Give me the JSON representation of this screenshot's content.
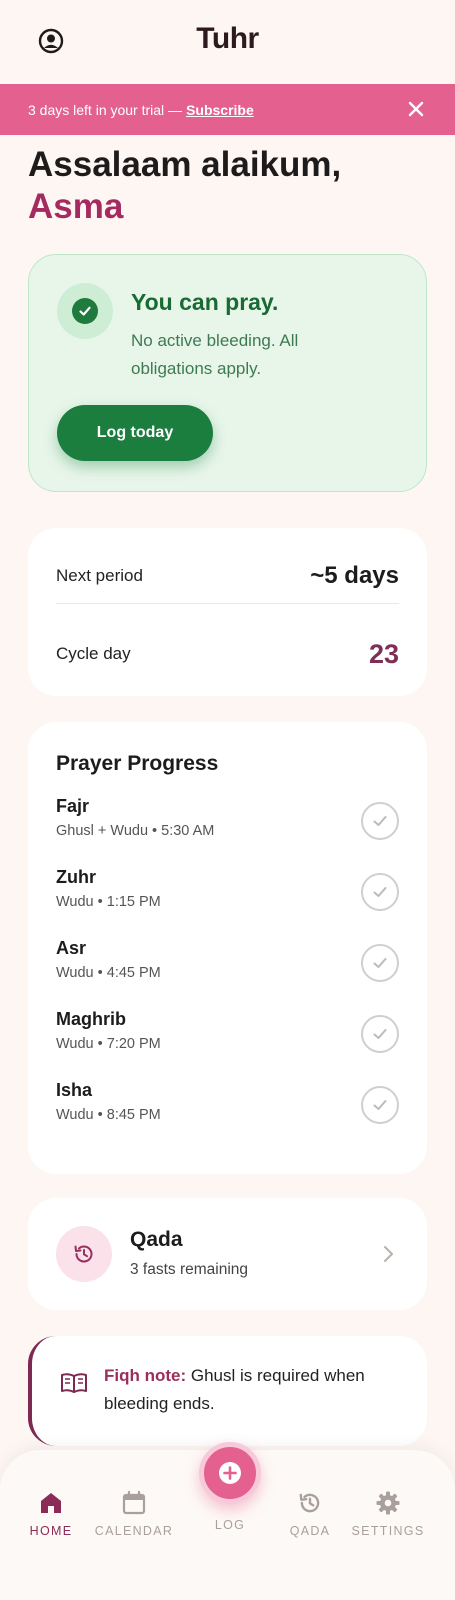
{
  "header": {
    "title": "Tuhr",
    "profile_icon": "user-circle-icon"
  },
  "banner": {
    "text": "3 days left in your trial — ",
    "link": "Subscribe",
    "close_icon": "close-icon",
    "color": "#e4608f"
  },
  "greeting": {
    "line1": "Assalaam alaikum,",
    "name": "Asma"
  },
  "status": {
    "icon": "check-circle-icon",
    "title": "You can pray.",
    "description": "No active bleeding. All obligations apply.",
    "button": "Log today",
    "accent": "#1b7d3e"
  },
  "cycle": {
    "next_label": "Next period",
    "next_value": "~5 days",
    "day_label": "Cycle day",
    "day_value": "23"
  },
  "prayers": {
    "title": "Prayer Progress",
    "items": [
      {
        "name": "Fajr",
        "detail": "Ghusl + Wudu • 5:30 AM",
        "done": false
      },
      {
        "name": "Zuhr",
        "detail": "Wudu • 1:15 PM",
        "done": false
      },
      {
        "name": "Asr",
        "detail": "Wudu • 4:45 PM",
        "done": false
      },
      {
        "name": "Maghrib",
        "detail": "Wudu • 7:20 PM",
        "done": false
      },
      {
        "name": "Isha",
        "detail": "Wudu • 8:45 PM",
        "done": false
      }
    ]
  },
  "qada": {
    "icon": "history-icon",
    "title": "Qada",
    "subtitle": "3 fasts remaining",
    "chevron": "chevron-right-icon"
  },
  "fiqh": {
    "icon": "book-icon",
    "label": "Fiqh note:",
    "text": " Ghusl is required when bleeding ends."
  },
  "nav": {
    "items": [
      {
        "label": "HOME",
        "icon": "home-icon",
        "active": true
      },
      {
        "label": "CALENDAR",
        "icon": "calendar-icon",
        "active": false
      },
      {
        "label": "LOG",
        "icon": "plus-icon",
        "active": false
      },
      {
        "label": "QADA",
        "icon": "history-icon",
        "active": false
      },
      {
        "label": "SETTINGS",
        "icon": "gear-icon",
        "active": false
      }
    ]
  }
}
